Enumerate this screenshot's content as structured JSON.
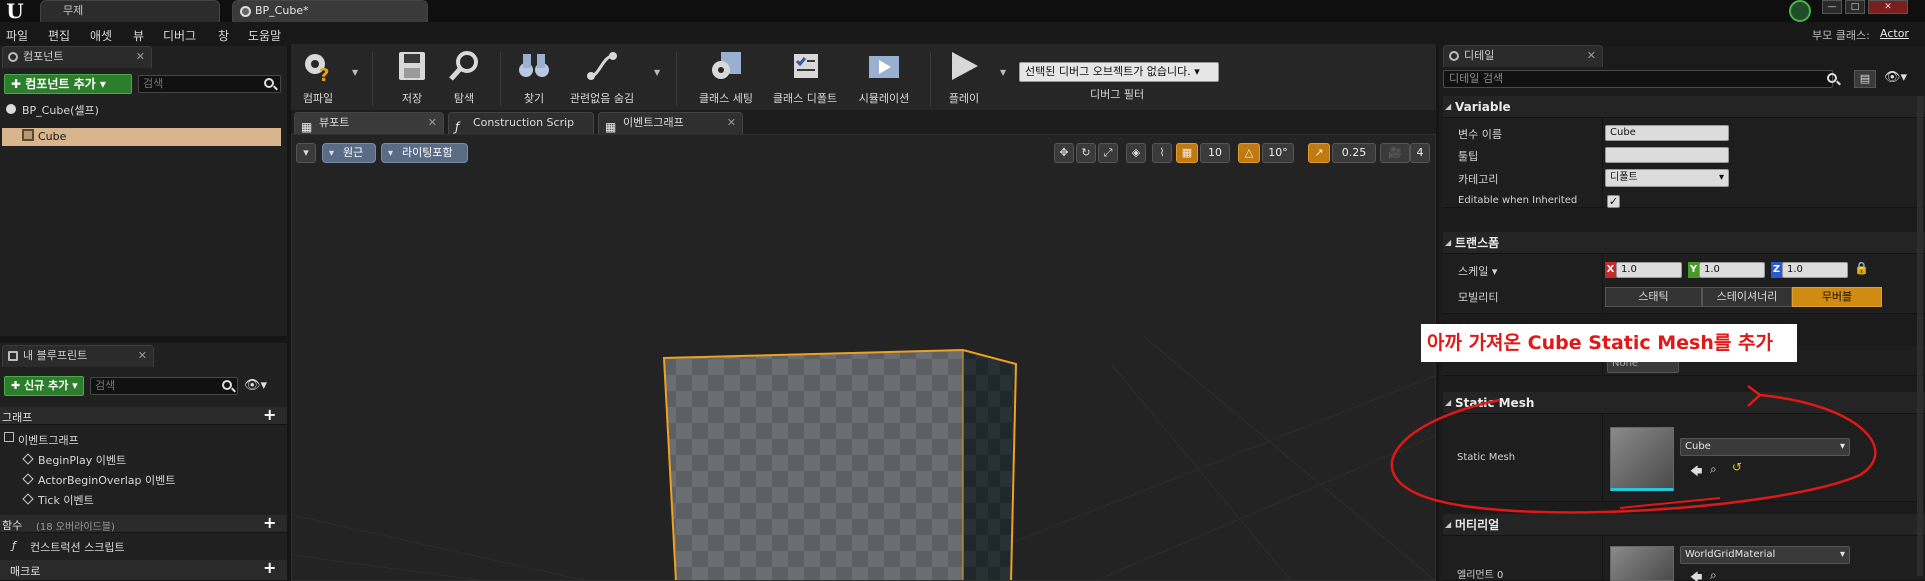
{
  "titlebar": {
    "tabs": [
      {
        "label": "무제"
      },
      {
        "label": "BP_Cube*"
      }
    ],
    "window_buttons": [
      "—",
      "□",
      "✕"
    ]
  },
  "menubar": {
    "items": [
      "파일",
      "편집",
      "애셋",
      "뷰",
      "디버그",
      "창",
      "도움말"
    ],
    "parent_class_label": "부모 클래스:",
    "parent_class_value": "Actor"
  },
  "components": {
    "tab_label": "컴포넌트",
    "add_button": "✚ 컴포넌트 추가 ▾",
    "search_placeholder": "검색",
    "root_label": "BP_Cube(셀프)",
    "cube_label": "Cube"
  },
  "blueprint": {
    "tab_label": "내 블루프린트",
    "add_button": "✚ 신규 추가 ▾",
    "search_placeholder": "검색",
    "graph_section": "그래프",
    "event_graph": "이벤트그래프",
    "events": [
      "BeginPlay 이벤트",
      "ActorBeginOverlap 이벤트",
      "Tick 이벤트"
    ],
    "functions_section": "함수",
    "functions_overridable": "(18 오버라이드블)",
    "construction_script": "컨스트럭션 스크립트",
    "macros_section": "매크로"
  },
  "toolbar": {
    "buttons": [
      {
        "label": "컴파일"
      },
      {
        "label": "저장"
      },
      {
        "label": "탐색"
      },
      {
        "label": "찾기"
      },
      {
        "label": "관련없음 숨김"
      },
      {
        "label": "클래스 세팅"
      },
      {
        "label": "클래스 디폴트"
      },
      {
        "label": "시뮬레이션"
      },
      {
        "label": "플레이"
      }
    ],
    "debug_select": "선택된 디버그 오브젝트가 없습니다. ▾",
    "debug_filter": "디버그 필터"
  },
  "editor_tabs": [
    {
      "label": "뷰포트"
    },
    {
      "label": "Construction Scrip"
    },
    {
      "label": "이벤트그래프"
    }
  ],
  "viewport": {
    "perspective_label": "원근",
    "lighting_label": "라이팅포함",
    "grid_snap": "10",
    "rotation_snap": "10°",
    "scale_snap": "0.25",
    "camera_speed": "4"
  },
  "details": {
    "tab_label": "디테일",
    "search_placeholder": "디테일 검색",
    "variable_section": "Variable",
    "var_name_label": "변수 이름",
    "var_name_value": "Cube",
    "tooltip_label": "툴팁",
    "tooltip_value": "",
    "category_label": "카테고리",
    "category_value": "디폴트",
    "editable_label": "Editable when Inherited",
    "editable_check": "✓",
    "transform_section": "트랜스폼",
    "scale_label": "스케일 ▾",
    "scale_x": "1.0",
    "scale_y": "1.0",
    "scale_z": "1.0",
    "mobility_label": "모빌리티",
    "mobility_options": [
      "스태틱",
      "스테이셔너리",
      "무버블"
    ],
    "socket_value": "None",
    "static_mesh_section": "Static Mesh",
    "static_mesh_label": "Static Mesh",
    "static_mesh_value": "Cube",
    "materials_section": "머티리얼",
    "element_label": "엘리먼트 0",
    "material_value": "WorldGridMaterial"
  },
  "annotation": {
    "text": "아까 가져온 Cube Static Mesh를 추가"
  },
  "colors": {
    "accent_green": "#2c7e2c",
    "selection_orange": "#f0a020",
    "annotation_red": "#e01818"
  }
}
